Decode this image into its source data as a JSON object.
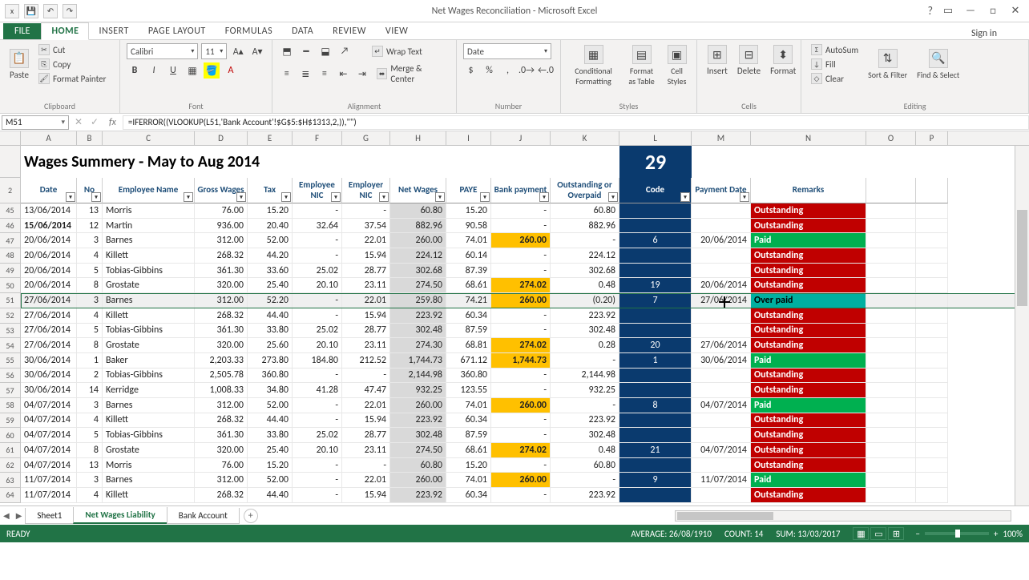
{
  "window": {
    "title": "Net Wages Reconciliation - Microsoft Excel"
  },
  "tabs": {
    "file": "FILE",
    "home": "HOME",
    "insert": "INSERT",
    "page": "PAGE LAYOUT",
    "formulas": "FORMULAS",
    "data": "DATA",
    "review": "REVIEW",
    "view": "VIEW",
    "signin": "Sign in"
  },
  "ribbon": {
    "clipboard": {
      "paste": "Paste",
      "cut": "Cut",
      "copy": "Copy",
      "fmtpaint": "Format Painter",
      "label": "Clipboard"
    },
    "font": {
      "name": "Calibri",
      "size": "11",
      "label": "Font"
    },
    "align": {
      "wrap": "Wrap Text",
      "merge": "Merge & Center",
      "label": "Alignment"
    },
    "number": {
      "fmt": "Date",
      "label": "Number"
    },
    "styles": {
      "cond": "Conditional Formatting",
      "table": "Format as Table",
      "cell": "Cell Styles",
      "label": "Styles"
    },
    "cells": {
      "insert": "Insert",
      "delete": "Delete",
      "format": "Format",
      "label": "Cells"
    },
    "editing": {
      "autosum": "AutoSum",
      "fill": "Fill",
      "clear": "Clear",
      "sort": "Sort & Filter",
      "find": "Find & Select",
      "label": "Editing"
    }
  },
  "formula": {
    "namebox": "M51",
    "value": "=IFERROR((VLOOKUP(L51,'Bank Account'!$G$5:$H$1313,2,)),\"\")"
  },
  "sheet_title": "Wages Summery  - May to Aug 2014",
  "code_big": "29",
  "columns": [
    "A",
    "B",
    "C",
    "D",
    "E",
    "F",
    "G",
    "H",
    "I",
    "J",
    "K",
    "L",
    "M",
    "N",
    "O",
    "P"
  ],
  "headers": {
    "date": "Date",
    "no": "No",
    "emp": "Employee Name",
    "gross": "Gross Wages",
    "tax": "Tax",
    "eenic": "Employee NIC",
    "ernic": "Employer NIC",
    "net": "Net Wages",
    "paye": "PAYE",
    "bank": "Bank payment",
    "out": "Outstanding or Overpaid",
    "code": "Code",
    "pdate": "Payment Date",
    "remarks": "Remarks"
  },
  "row_header_start": 2,
  "row_numbers": [
    45,
    46,
    47,
    48,
    49,
    50,
    51,
    52,
    53,
    54,
    55,
    56,
    57,
    58,
    59,
    60,
    61,
    62,
    63,
    64
  ],
  "rows": [
    {
      "date": "13/06/2014",
      "no": "13",
      "emp": "Morris",
      "gross": "76.00",
      "tax": "15.20",
      "eenic": "-",
      "ernic": "-",
      "net": "60.80",
      "paye": "15.20",
      "bank": "-",
      "bp": false,
      "out": "60.80",
      "code": "",
      "pdate": "",
      "remark": "Outstanding",
      "rc": "out"
    },
    {
      "date": "15/06/2014",
      "bold": true,
      "no": "12",
      "emp": "Martin",
      "gross": "936.00",
      "tax": "20.40",
      "eenic": "32.64",
      "ernic": "37.54",
      "net": "882.96",
      "paye": "90.58",
      "bank": "-",
      "bp": false,
      "out": "882.96",
      "code": "",
      "pdate": "",
      "remark": "Outstanding",
      "rc": "out"
    },
    {
      "date": "20/06/2014",
      "no": "3",
      "emp": "Barnes",
      "gross": "312.00",
      "tax": "52.00",
      "eenic": "-",
      "ernic": "22.01",
      "net": "260.00",
      "paye": "74.01",
      "bank": "260.00",
      "bp": true,
      "out": "-",
      "code": "6",
      "pdate": "20/06/2014",
      "remark": "Paid",
      "rc": "paid"
    },
    {
      "date": "20/06/2014",
      "no": "4",
      "emp": "Killett",
      "gross": "268.32",
      "tax": "44.20",
      "eenic": "-",
      "ernic": "15.94",
      "net": "224.12",
      "paye": "60.14",
      "bank": "-",
      "bp": false,
      "out": "224.12",
      "code": "",
      "pdate": "",
      "remark": "Outstanding",
      "rc": "out"
    },
    {
      "date": "20/06/2014",
      "no": "5",
      "emp": "Tobias-Gibbins",
      "gross": "361.30",
      "tax": "33.60",
      "eenic": "25.02",
      "ernic": "28.77",
      "net": "302.68",
      "paye": "87.39",
      "bank": "-",
      "bp": false,
      "out": "302.68",
      "code": "",
      "pdate": "",
      "remark": "Outstanding",
      "rc": "out"
    },
    {
      "date": "20/06/2014",
      "no": "8",
      "emp": "Grostate",
      "gross": "320.00",
      "tax": "25.40",
      "eenic": "20.10",
      "ernic": "23.11",
      "net": "274.50",
      "paye": "68.61",
      "bank": "274.02",
      "bp": true,
      "out": "0.48",
      "code": "19",
      "pdate": "20/06/2014",
      "remark": "Outstanding",
      "rc": "out"
    },
    {
      "date": "27/06/2014",
      "no": "3",
      "emp": "Barnes",
      "gross": "312.00",
      "tax": "52.20",
      "eenic": "-",
      "ernic": "22.01",
      "net": "259.80",
      "paye": "74.21",
      "bank": "260.00",
      "bp": true,
      "out": "(0.20)",
      "code": "7",
      "pdate": "27/06/2014",
      "remark": "Over paid",
      "rc": "over",
      "selected": true
    },
    {
      "date": "27/06/2014",
      "no": "4",
      "emp": "Killett",
      "gross": "268.32",
      "tax": "44.40",
      "eenic": "-",
      "ernic": "15.94",
      "net": "223.92",
      "paye": "60.34",
      "bank": "-",
      "bp": false,
      "out": "223.92",
      "code": "",
      "pdate": "",
      "remark": "Outstanding",
      "rc": "out"
    },
    {
      "date": "27/06/2014",
      "no": "5",
      "emp": "Tobias-Gibbins",
      "gross": "361.30",
      "tax": "33.80",
      "eenic": "25.02",
      "ernic": "28.77",
      "net": "302.48",
      "paye": "87.59",
      "bank": "-",
      "bp": false,
      "out": "302.48",
      "code": "",
      "pdate": "",
      "remark": "Outstanding",
      "rc": "out"
    },
    {
      "date": "27/06/2014",
      "no": "8",
      "emp": "Grostate",
      "gross": "320.00",
      "tax": "25.60",
      "eenic": "20.10",
      "ernic": "23.11",
      "net": "274.30",
      "paye": "68.81",
      "bank": "274.02",
      "bp": true,
      "out": "0.28",
      "code": "20",
      "pdate": "27/06/2014",
      "remark": "Outstanding",
      "rc": "out"
    },
    {
      "date": "30/06/2014",
      "no": "1",
      "emp": "Baker",
      "gross": "2,203.33",
      "tax": "273.80",
      "eenic": "184.80",
      "ernic": "212.52",
      "net": "1,744.73",
      "paye": "671.12",
      "bank": "1,744.73",
      "bp": true,
      "out": "-",
      "code": "1",
      "pdate": "30/06/2014",
      "remark": "Paid",
      "rc": "paid"
    },
    {
      "date": "30/06/2014",
      "no": "2",
      "emp": "Tobias-Gibbins",
      "gross": "2,505.78",
      "tax": "360.80",
      "eenic": "-",
      "ernic": "-",
      "net": "2,144.98",
      "paye": "360.80",
      "bank": "-",
      "bp": false,
      "out": "2,144.98",
      "code": "",
      "pdate": "",
      "remark": "Outstanding",
      "rc": "out"
    },
    {
      "date": "30/06/2014",
      "no": "14",
      "emp": "Kerridge",
      "gross": "1,008.33",
      "tax": "34.80",
      "eenic": "41.28",
      "ernic": "47.47",
      "net": "932.25",
      "paye": "123.55",
      "bank": "-",
      "bp": false,
      "out": "932.25",
      "code": "",
      "pdate": "",
      "remark": "Outstanding",
      "rc": "out"
    },
    {
      "date": "04/07/2014",
      "no": "3",
      "emp": "Barnes",
      "gross": "312.00",
      "tax": "52.00",
      "eenic": "-",
      "ernic": "22.01",
      "net": "260.00",
      "paye": "74.01",
      "bank": "260.00",
      "bp": true,
      "out": "-",
      "code": "8",
      "pdate": "04/07/2014",
      "remark": "Paid",
      "rc": "paid"
    },
    {
      "date": "04/07/2014",
      "no": "4",
      "emp": "Killett",
      "gross": "268.32",
      "tax": "44.40",
      "eenic": "-",
      "ernic": "15.94",
      "net": "223.92",
      "paye": "60.34",
      "bank": "-",
      "bp": false,
      "out": "223.92",
      "code": "",
      "pdate": "",
      "remark": "Outstanding",
      "rc": "out"
    },
    {
      "date": "04/07/2014",
      "no": "5",
      "emp": "Tobias-Gibbins",
      "gross": "361.30",
      "tax": "33.80",
      "eenic": "25.02",
      "ernic": "28.77",
      "net": "302.48",
      "paye": "87.59",
      "bank": "-",
      "bp": false,
      "out": "302.48",
      "code": "",
      "pdate": "",
      "remark": "Outstanding",
      "rc": "out"
    },
    {
      "date": "04/07/2014",
      "no": "8",
      "emp": "Grostate",
      "gross": "320.00",
      "tax": "25.40",
      "eenic": "20.10",
      "ernic": "23.11",
      "net": "274.50",
      "paye": "68.61",
      "bank": "274.02",
      "bp": true,
      "out": "0.48",
      "code": "21",
      "pdate": "04/07/2014",
      "remark": "Outstanding",
      "rc": "out"
    },
    {
      "date": "04/07/2014",
      "no": "13",
      "emp": "Morris",
      "gross": "76.00",
      "tax": "15.20",
      "eenic": "-",
      "ernic": "-",
      "net": "60.80",
      "paye": "15.20",
      "bank": "-",
      "bp": false,
      "out": "60.80",
      "code": "",
      "pdate": "",
      "remark": "Outstanding",
      "rc": "out"
    },
    {
      "date": "11/07/2014",
      "no": "3",
      "emp": "Barnes",
      "gross": "312.00",
      "tax": "52.00",
      "eenic": "-",
      "ernic": "22.01",
      "net": "260.00",
      "paye": "74.01",
      "bank": "260.00",
      "bp": true,
      "out": "-",
      "code": "9",
      "pdate": "11/07/2014",
      "remark": "Paid",
      "rc": "paid"
    },
    {
      "date": "11/07/2014",
      "no": "4",
      "emp": "Killett",
      "gross": "268.32",
      "tax": "44.40",
      "eenic": "-",
      "ernic": "15.94",
      "net": "223.92",
      "paye": "60.34",
      "bank": "-",
      "bp": false,
      "out": "223.92",
      "code": "",
      "pdate": "",
      "remark": "Outstanding",
      "rc": "out"
    }
  ],
  "sheettabs": {
    "s1": "Sheet1",
    "s2": "Net Wages Liability",
    "s3": "Bank Account"
  },
  "status": {
    "ready": "READY",
    "avg": "AVERAGE: 26/08/1910",
    "count": "COUNT: 14",
    "sum": "SUM: 13/03/2017",
    "zoom": "100%"
  }
}
